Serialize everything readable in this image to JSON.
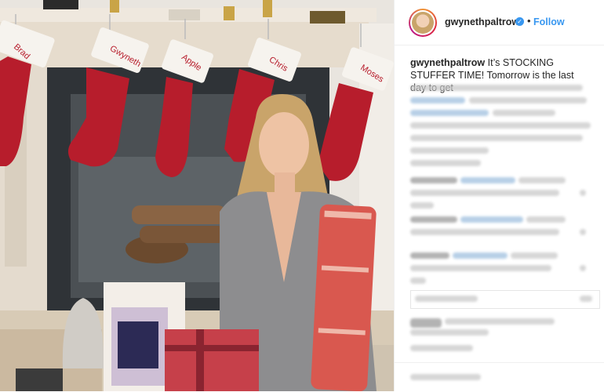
{
  "post": {
    "username": "gwynethpaltrow",
    "verified_icon": "verified-badge-icon",
    "separator": "•",
    "follow_label": "Follow",
    "caption_user": "gwynethpaltrow",
    "caption_text": "It’s STOCKING STUFFER TIME! Tomorrow is the last day to get"
  },
  "photo": {
    "stockings": [
      {
        "name": "Brad"
      },
      {
        "name": "Gwyneth"
      },
      {
        "name": "Apple"
      },
      {
        "name": "Chris"
      },
      {
        "name": "Moses"
      }
    ]
  },
  "colors": {
    "link_blue": "#3897f0",
    "text": "#262626",
    "stocking_red": "#b71d2c"
  }
}
